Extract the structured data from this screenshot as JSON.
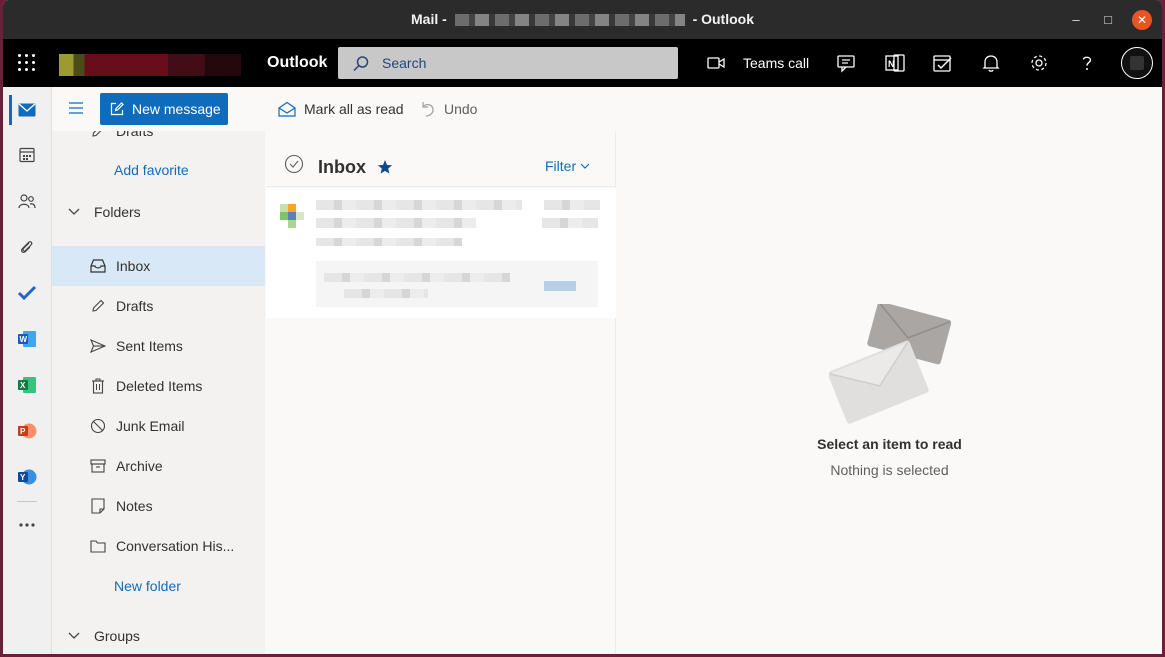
{
  "window": {
    "title_prefix": "Mail -",
    "title_suffix": "- Outlook",
    "minimize_glyph": "–",
    "maximize_glyph": "□",
    "close_glyph": "✕"
  },
  "header": {
    "app_name": "Outlook",
    "search_placeholder": "Search",
    "teams_call_label": "Teams call",
    "icons": [
      "app-launcher-icon",
      "video-camera-icon",
      "chat-icon",
      "onenote-feed-icon",
      "my-day-icon",
      "bell-icon",
      "gear-icon",
      "help-icon"
    ]
  },
  "rail": {
    "items": [
      "mail-icon",
      "calendar-icon",
      "people-icon",
      "attachment-icon",
      "todo-icon",
      "word-icon",
      "excel-icon",
      "powerpoint-icon",
      "yammer-icon",
      "more-apps-icon"
    ]
  },
  "toolbar": {
    "new_message_label": "New message",
    "mark_all_read_label": "Mark all as read",
    "undo_label": "Undo"
  },
  "folders": {
    "partial_item": "Drafts",
    "add_favorite": "Add favorite",
    "folders_heading": "Folders",
    "items": [
      {
        "label": "Inbox",
        "icon": "inbox-icon",
        "selected": true
      },
      {
        "label": "Drafts",
        "icon": "pencil-icon",
        "selected": false
      },
      {
        "label": "Sent Items",
        "icon": "send-icon",
        "selected": false
      },
      {
        "label": "Deleted Items",
        "icon": "trash-icon",
        "selected": false
      },
      {
        "label": "Junk Email",
        "icon": "blocked-icon",
        "selected": false
      },
      {
        "label": "Archive",
        "icon": "archive-icon",
        "selected": false
      },
      {
        "label": "Notes",
        "icon": "note-icon",
        "selected": false
      },
      {
        "label": "Conversation His...",
        "icon": "folder-icon",
        "selected": false
      }
    ],
    "new_folder": "New folder",
    "groups_heading": "Groups"
  },
  "message_list": {
    "title": "Inbox",
    "filter_label": "Filter"
  },
  "reading_pane": {
    "empty_title": "Select an item to read",
    "empty_subtitle": "Nothing is selected"
  },
  "colors": {
    "accent": "#0f6cbd",
    "selected_folder": "#d9e8f6",
    "header_bg": "#000000",
    "titlebar_bg": "#2b2b2b",
    "close_button": "#e95420"
  }
}
